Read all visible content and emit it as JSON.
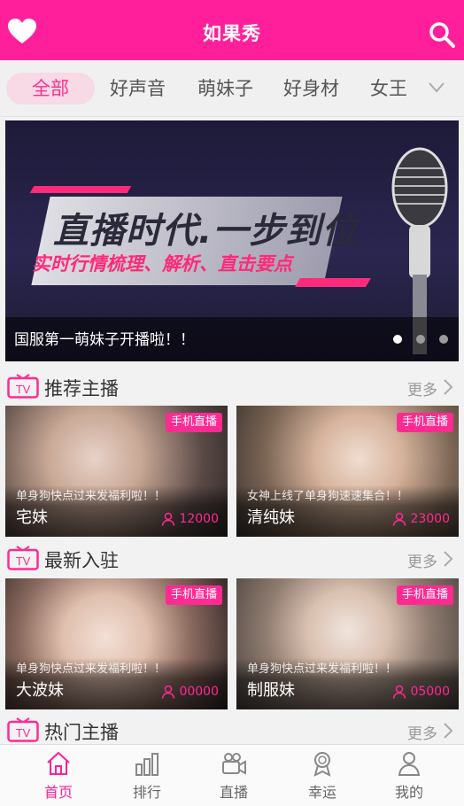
{
  "header": {
    "title": "如果秀"
  },
  "tabs": [
    {
      "label": "全部",
      "active": true
    },
    {
      "label": "好声音"
    },
    {
      "label": "萌妹子"
    },
    {
      "label": "好身材"
    },
    {
      "label": "女王"
    }
  ],
  "banner": {
    "headline": "直播时代.一步到位",
    "subheadline": "实时行情梳理、解析、直击要点",
    "caption": "国服第一萌妹子开播啦！！",
    "dots": 3,
    "active_dot": 0
  },
  "sections": [
    {
      "title": "推荐主播",
      "more": "更多",
      "cards": [
        {
          "badge": "手机直播",
          "subtitle": "单身狗快点过来发福利啦！！",
          "name": "宅妹",
          "viewers": "12000"
        },
        {
          "badge": "手机直播",
          "subtitle": "女神上线了单身狗速速集合！！",
          "name": "清纯妹",
          "viewers": "23000"
        }
      ]
    },
    {
      "title": "最新入驻",
      "more": "更多",
      "cards": [
        {
          "badge": "手机直播",
          "subtitle": "单身狗快点过来发福利啦！！",
          "name": "大波妹",
          "viewers": "00000"
        },
        {
          "badge": "手机直播",
          "subtitle": "单身狗快点过来发福利啦！！",
          "name": "制服妹",
          "viewers": "05000"
        }
      ]
    },
    {
      "title": "热门主播",
      "more": "更多"
    }
  ],
  "bottom_nav": [
    {
      "label": "首页",
      "icon": "home-icon",
      "active": true
    },
    {
      "label": "排行",
      "icon": "bar-chart-icon"
    },
    {
      "label": "直播",
      "icon": "video-camera-icon"
    },
    {
      "label": "幸运",
      "icon": "medal-icon"
    },
    {
      "label": "我的",
      "icon": "person-icon"
    }
  ],
  "colors": {
    "brand": "#ff1f9b",
    "badge": "#ff2a92",
    "tab_active_bg": "#f8d9e6"
  }
}
